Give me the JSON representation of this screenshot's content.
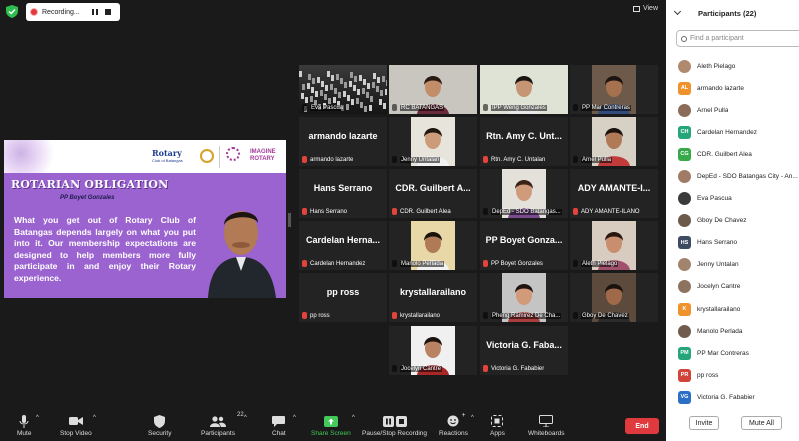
{
  "recording": {
    "label": "Recording..."
  },
  "view": {
    "label": "View"
  },
  "slide": {
    "org": "Rotary",
    "org_sub": "Club of Batangas",
    "theme_line1": "IMAGINE",
    "theme_line2": "ROTARY",
    "title": "ROTARIAN OBLIGATION",
    "subtitle": "PP Boyet Gonzales",
    "body": "What you get out of Rotary Club of Batangas depends largely on what you put into it.  Our membership expectations are designed to help members more fully participate in and enjoy their Rotary experience."
  },
  "tiles": [
    {
      "label": "Eva Pascua",
      "name": ""
    },
    {
      "label": "RC BATANGAS",
      "name": ""
    },
    {
      "label": "IPP Weng Gonzales",
      "name": ""
    },
    {
      "label": "PP Mar Contreras",
      "name": ""
    },
    {
      "label": "armando lazarte",
      "name": "armando lazarte"
    },
    {
      "label": "Jenny Untalan",
      "name": ""
    },
    {
      "label": "Rtn. Amy C. Untalan",
      "name": "Rtn. Amy C. Unt..."
    },
    {
      "label": "Arnel Pulla",
      "name": ""
    },
    {
      "label": "Hans Serrano",
      "name": "Hans Serrano"
    },
    {
      "label": "CDR. Guilbert Alea",
      "name": "CDR. Guilbert A..."
    },
    {
      "label": "DepEd - SDO Batangas...",
      "name": ""
    },
    {
      "label": "ADY AMANTE-ILANO",
      "name": "ADY AMANTE-I..."
    },
    {
      "label": "Cardelan Hernandez",
      "name": "Cardelan Herna..."
    },
    {
      "label": "Manolo Perlada",
      "name": ""
    },
    {
      "label": "PP Boyet Gonzales",
      "name": "PP Boyet Gonza..."
    },
    {
      "label": "Aleth Pielago",
      "name": ""
    },
    {
      "label": "pp ross",
      "name": "pp ross"
    },
    {
      "label": "krystallarailano",
      "name": "krystallarailano"
    },
    {
      "label": "Pheng Ramirez De Cha...",
      "name": ""
    },
    {
      "label": "Gboy De Chavez",
      "name": ""
    },
    {
      "label": "Jocelyn Cantre",
      "name": ""
    },
    {
      "label": "Victoria G. Fababier",
      "name": "Victoria G. Faba..."
    }
  ],
  "toolbar": {
    "mute": "Mute",
    "stop_video": "Stop Video",
    "security": "Security",
    "participants": "Participants",
    "participants_count": "22",
    "chat": "Chat",
    "share_screen": "Share Screen",
    "record": "Pause/Stop Recording",
    "reactions": "Reactions",
    "apps": "Apps",
    "whiteboards": "Whiteboards",
    "end": "End"
  },
  "panel": {
    "title": "Participants (22)",
    "search_placeholder": "Find a participant",
    "participants": [
      {
        "name": "Aleth Pielago",
        "initials": "",
        "color": "#b08a6e"
      },
      {
        "name": "armando lazarte",
        "initials": "AL",
        "color": "#f0922b"
      },
      {
        "name": "Arnel Pulla",
        "initials": "",
        "color": "#8a6c58"
      },
      {
        "name": "Cardelan Hernandez",
        "initials": "CH",
        "color": "#25a57a"
      },
      {
        "name": "CDR. Guilbert Alea",
        "initials": "CG",
        "color": "#38a94a"
      },
      {
        "name": "DepEd - SDO Batangas City - An...",
        "initials": "",
        "color": "#a07c66"
      },
      {
        "name": "Eva Pascua",
        "initials": "",
        "color": "#3a3a3a"
      },
      {
        "name": "Gboy De Chavez",
        "initials": "",
        "color": "#6b5a4a"
      },
      {
        "name": "Hans Serrano",
        "initials": "HS",
        "color": "#3d4b63"
      },
      {
        "name": "Jenny Untalan",
        "initials": "",
        "color": "#a2836d"
      },
      {
        "name": "Jocelyn Cantre",
        "initials": "",
        "color": "#8d7260"
      },
      {
        "name": "krystallarailano",
        "initials": "K",
        "color": "#f0922b"
      },
      {
        "name": "Manolo Perlada",
        "initials": "",
        "color": "#6f5c4e"
      },
      {
        "name": "PP Mar Contreras",
        "initials": "PM",
        "color": "#25a57a"
      },
      {
        "name": "pp ross",
        "initials": "PR",
        "color": "#d2433a"
      },
      {
        "name": "Victoria G. Fababier",
        "initials": "VG",
        "color": "#2d6fc4"
      }
    ],
    "invite": "Invite",
    "mute_all": "Mute All"
  }
}
